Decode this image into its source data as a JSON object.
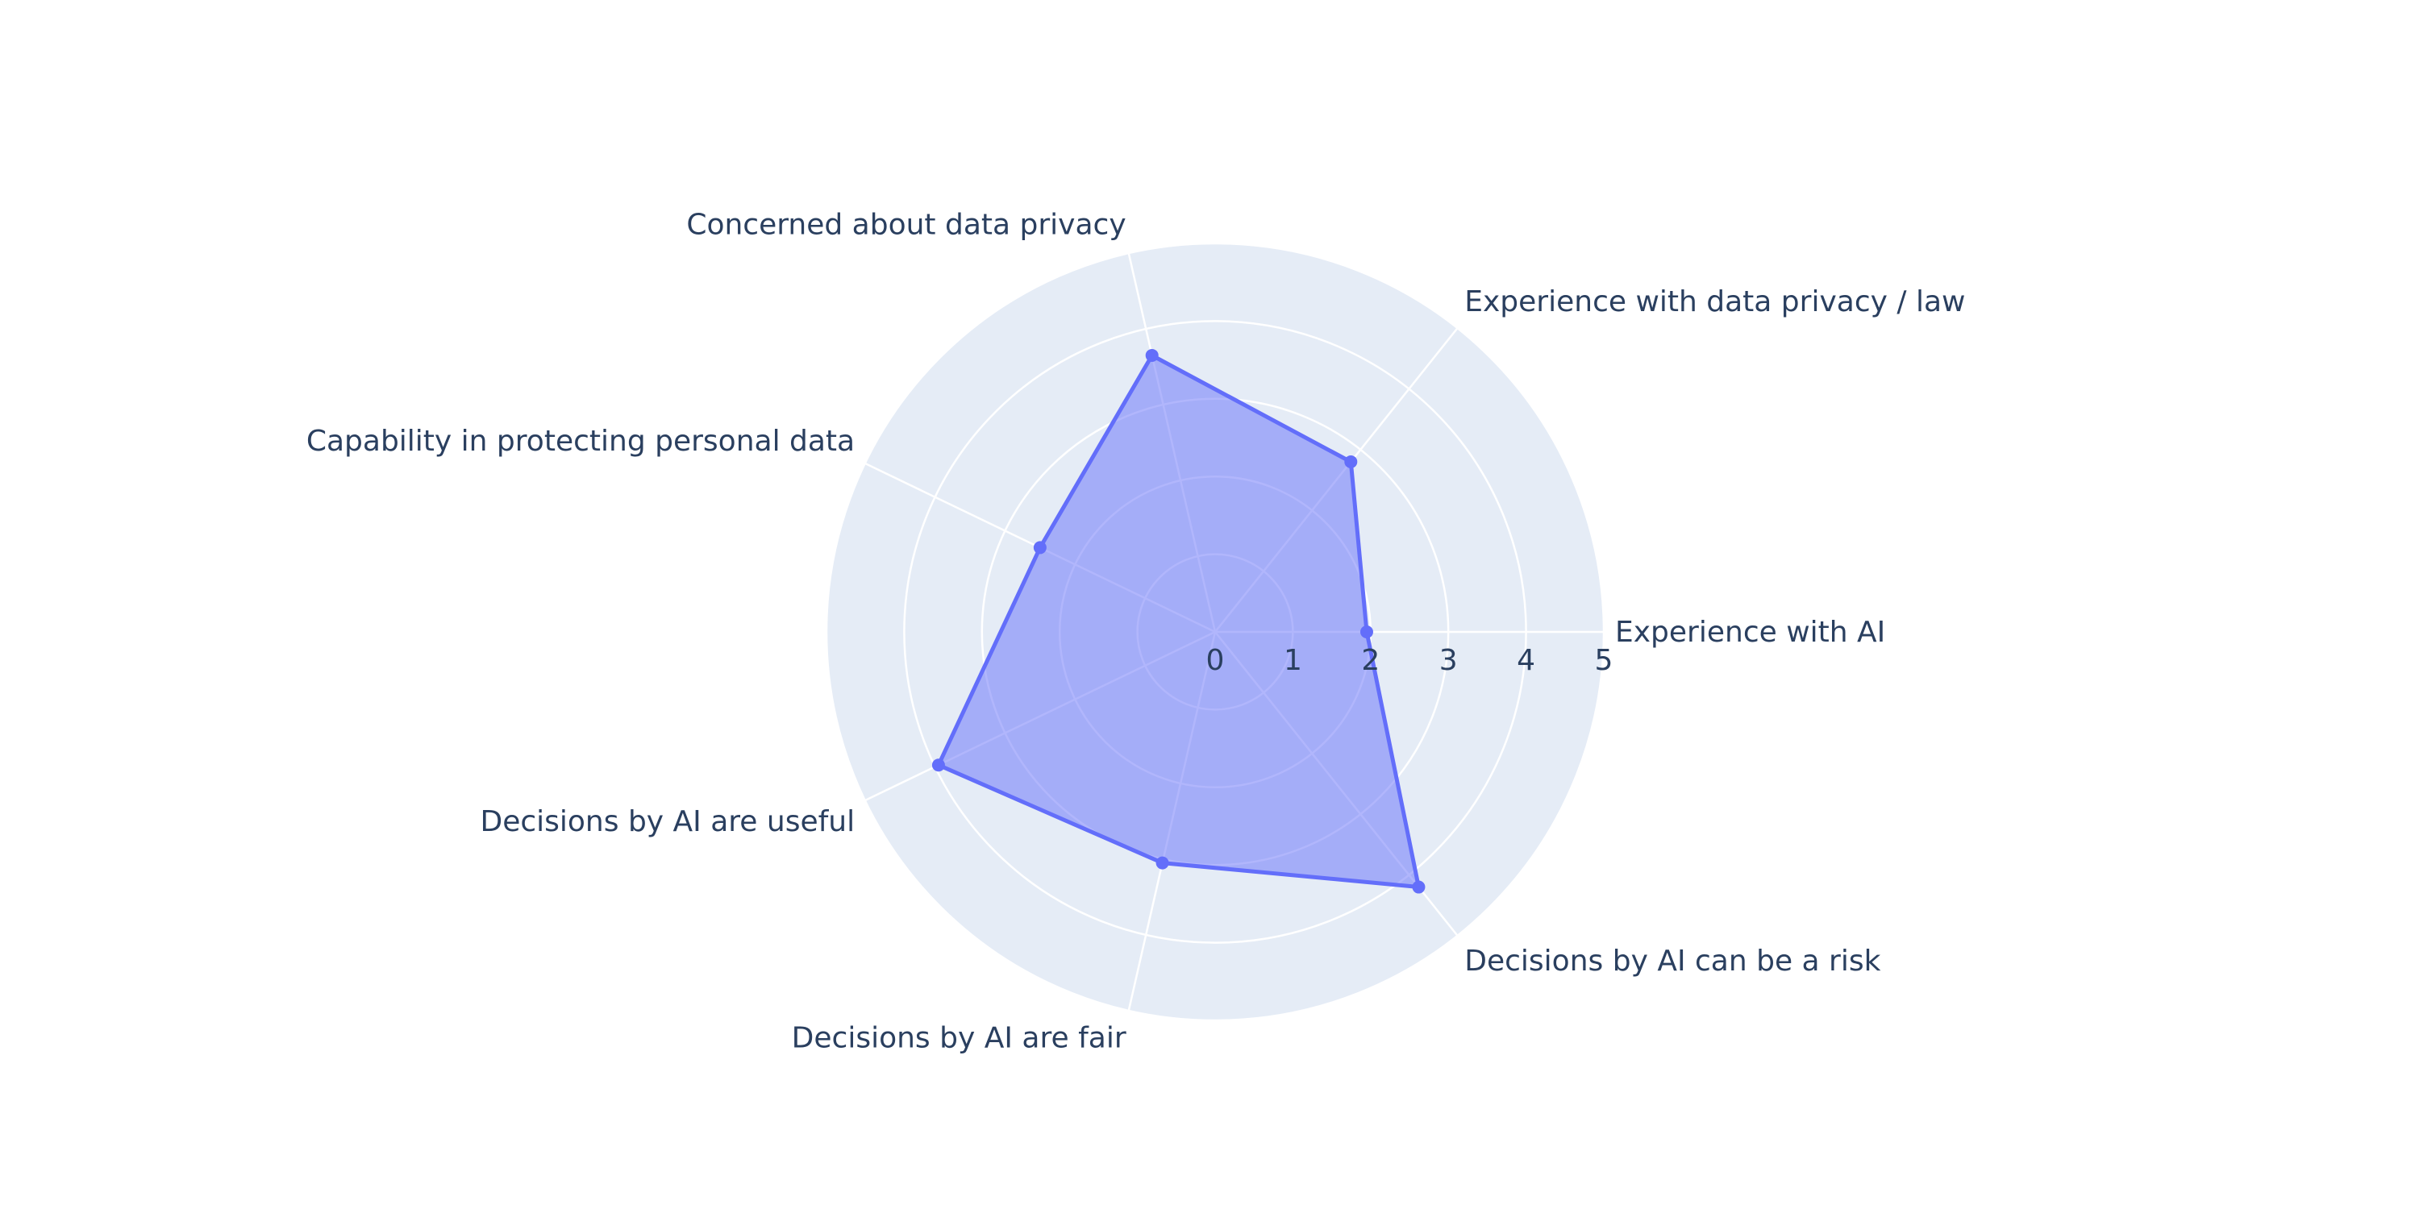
{
  "chart_data": {
    "type": "radar",
    "title": "",
    "categories": [
      "Experience with AI",
      "Experience with data privacy / law",
      "Concerned about data privacy",
      "Capability in protecting personal data",
      "Decisions by AI are useful",
      "Decisions by AI are fair",
      "Decisions by AI can be a risk"
    ],
    "series": [
      {
        "values": [
          1.95,
          2.8,
          3.65,
          2.5,
          3.95,
          3.05,
          4.2
        ]
      }
    ],
    "radial_range": [
      0,
      5
    ],
    "radial_ticks": [
      "0",
      "1",
      "2",
      "3",
      "4",
      "5"
    ],
    "grid": true,
    "colors": {
      "polar_background": "#e5ecf6",
      "gridline": "#ffffff",
      "series_line": "#636efa",
      "series_fill": "rgba(99,110,250,0.5)",
      "text": "#2a3f5f"
    }
  }
}
